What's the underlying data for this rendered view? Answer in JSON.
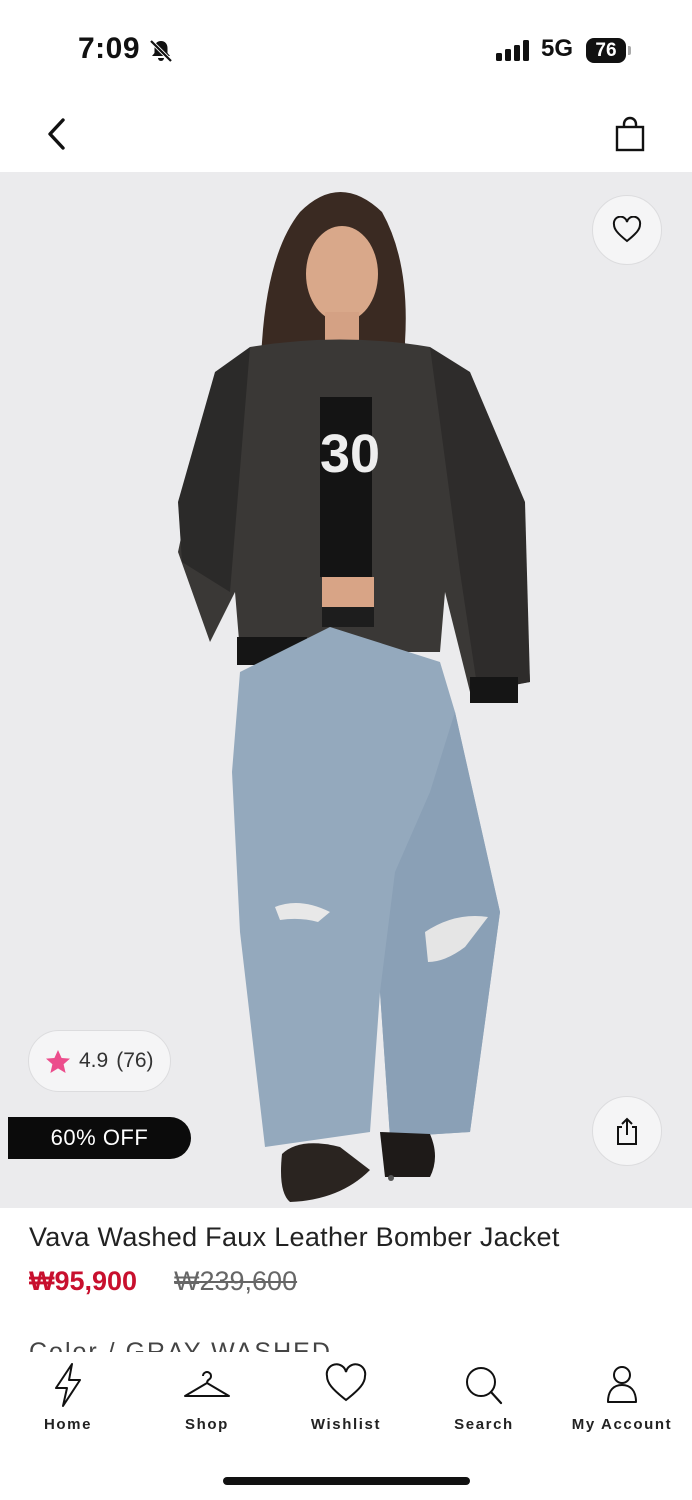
{
  "status_bar": {
    "time": "7:09",
    "network": "5G",
    "battery": "76"
  },
  "product": {
    "rating": "4.9",
    "reviews": "(76)",
    "discount_tag": "60% OFF",
    "title": "Vava Washed Faux Leather Bomber Jacket",
    "price": "₩95,900",
    "original_price": "₩239,600",
    "color_line": "Color / GRAY WASHED",
    "accent_color": "#c8102e",
    "star_color": "#ec4d8c"
  },
  "nav": {
    "items": [
      {
        "label": "Home",
        "icon": "bolt-icon"
      },
      {
        "label": "Shop",
        "icon": "hanger-icon"
      },
      {
        "label": "Wishlist",
        "icon": "heart-icon"
      },
      {
        "label": "Search",
        "icon": "search-icon"
      },
      {
        "label": "My Account",
        "icon": "account-icon"
      }
    ]
  }
}
